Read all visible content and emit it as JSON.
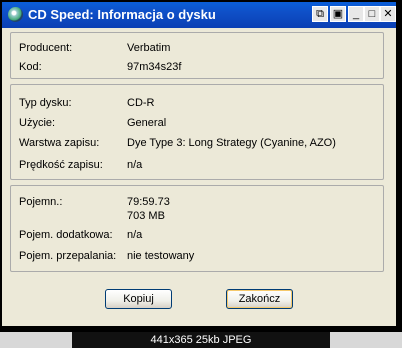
{
  "window": {
    "title": "CD Speed: Informacja o dysku",
    "controls": [
      "copy-icon",
      "save-icon",
      "minimize-icon",
      "maximize-icon",
      "close-icon"
    ],
    "control_glyphs": {
      "minimize": "_",
      "maximize": "□",
      "close": "✕",
      "copy": "⧉",
      "save": "▣"
    }
  },
  "group1": {
    "rows": [
      {
        "label": "Producent:",
        "value": "Verbatim"
      },
      {
        "label": "Kod:",
        "value": "97m34s23f"
      }
    ]
  },
  "group2": {
    "rows": [
      {
        "label": "Typ dysku:",
        "value": "CD-R"
      },
      {
        "label": "Użycie:",
        "value": "General"
      },
      {
        "label": "Warstwa zapisu:",
        "value": "Dye Type 3: Long Strategy (Cyanine, AZO)"
      },
      {
        "label": "Prędkość zapisu:",
        "value": "n/a"
      }
    ]
  },
  "group3": {
    "rows": [
      {
        "label": "Pojemn.:",
        "value": "79:59.73",
        "value2": "703 MB"
      },
      {
        "label": "Pojem. dodatkowa:",
        "value": "n/a"
      },
      {
        "label": "Pojem. przepalania:",
        "value": "nie testowany"
      }
    ]
  },
  "buttons": {
    "copy": "Kopiuj",
    "close": "Zakończ"
  },
  "caption": "441x365  25kb  JPEG",
  "colors": {
    "titlebar": "#0a4fc7",
    "window_bg": "#ece9d8",
    "button_border": "#003c74"
  }
}
